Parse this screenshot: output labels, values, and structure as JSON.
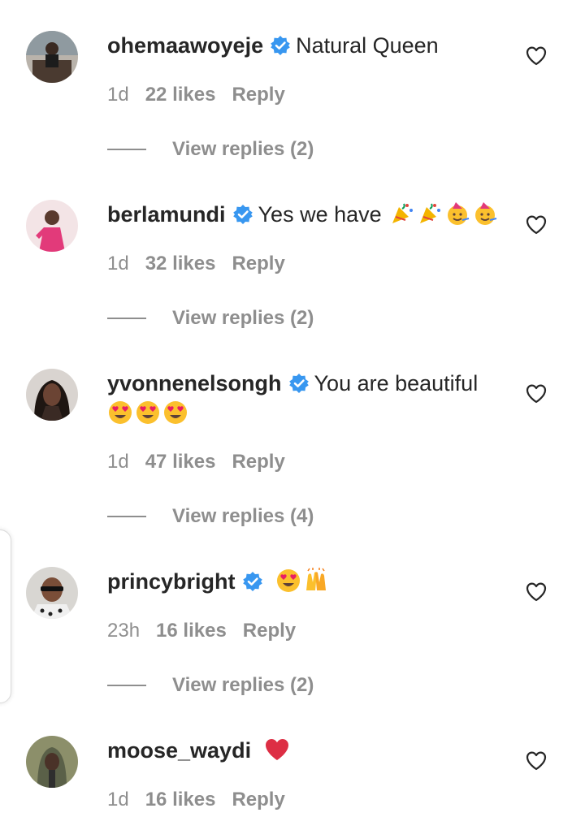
{
  "comments": [
    {
      "username": "ohemaawoyeje",
      "text": "Natural Queen",
      "time": "1d",
      "likes": "22 likes",
      "reply": "Reply",
      "view_replies": "View replies (2)",
      "avatar_icon": "avatar-woman-podium",
      "emoji": []
    },
    {
      "username": "berlamundi",
      "text": "Yes we have",
      "time": "1d",
      "likes": "32 likes",
      "reply": "Reply",
      "view_replies": "View replies (2)",
      "avatar_icon": "avatar-woman-pink-dress",
      "emoji": [
        "party-popper",
        "party-popper",
        "partying-face",
        "partying-face"
      ]
    },
    {
      "username": "yvonnenelsongh",
      "text": "You are beautiful",
      "time": "1d",
      "likes": "47 likes",
      "reply": "Reply",
      "view_replies": "View replies (4)",
      "avatar_icon": "avatar-woman-portrait",
      "emoji": [
        "heart-eyes",
        "heart-eyes",
        "heart-eyes"
      ]
    },
    {
      "username": "princybright",
      "text": "",
      "time": "23h",
      "likes": "16 likes",
      "reply": "Reply",
      "view_replies": "View replies (2)",
      "avatar_icon": "avatar-man-sunglasses",
      "emoji": [
        "heart-eyes",
        "raising-hands"
      ]
    },
    {
      "username": "moose_waydi",
      "text": "",
      "time": "1d",
      "likes": "16 likes",
      "reply": "Reply",
      "avatar_icon": "avatar-man-hoodie",
      "emoji": [
        "red-heart"
      ]
    }
  ],
  "colors": {
    "text": "#262626",
    "secondary": "#8e8e8e",
    "verified": "#3897f0"
  }
}
